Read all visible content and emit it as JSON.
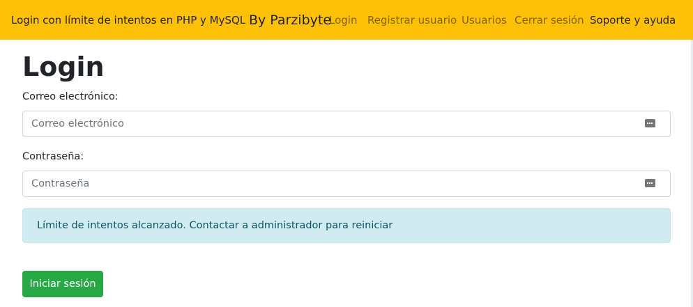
{
  "navbar": {
    "brand_text": "Login con límite de intentos en PHP y MySQL",
    "brand_byline": "By Parzibyte",
    "links": [
      {
        "label": "Login"
      },
      {
        "label": "Registrar usuario"
      },
      {
        "label": "Usuarios"
      },
      {
        "label": "Cerrar sesión"
      },
      {
        "label": "Soporte y ayuda"
      }
    ],
    "background_color": "#ffc107"
  },
  "main": {
    "title": "Login",
    "email": {
      "label": "Correo electrónico:",
      "placeholder": "Correo electrónico",
      "value": "",
      "icon": "keyboard-icon"
    },
    "password": {
      "label": "Contraseña:",
      "placeholder": "Contraseña",
      "value": "",
      "icon": "keyboard-icon"
    },
    "alert": {
      "text": "Límite de intentos alcanzado. Contactar a administrador para reiniciar",
      "background_color": "#d1ecf1",
      "text_color": "#0c5460"
    },
    "submit_label": "Iniciar sesión",
    "submit_color": "#28a745"
  }
}
